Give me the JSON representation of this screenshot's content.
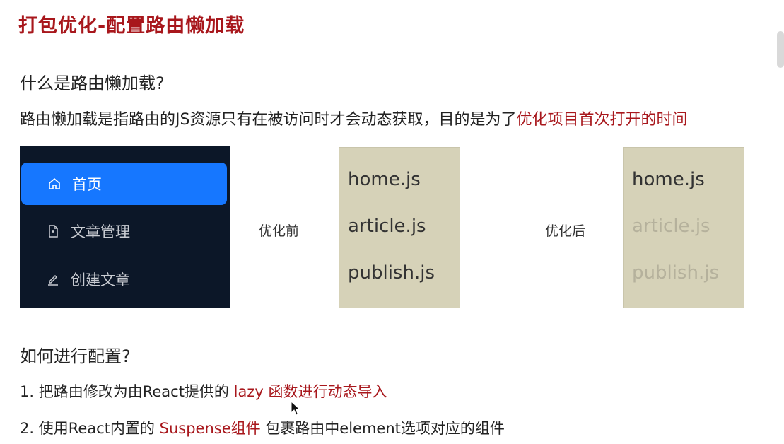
{
  "title": "打包优化-配置路由懒加载",
  "section1": {
    "question": "什么是路由懒加载?",
    "desc_plain": "路由懒加载是指路由的JS资源只有在被访问时才会动态获取，目的是为了",
    "desc_highlight": "优化项目首次打开的时间"
  },
  "menu": {
    "items": [
      {
        "label": "首页",
        "icon": "home-icon",
        "active": true
      },
      {
        "label": "文章管理",
        "icon": "document-icon",
        "active": false
      },
      {
        "label": "创建文章",
        "icon": "edit-icon",
        "active": false
      }
    ],
    "colors": {
      "background": "#0c1728",
      "active": "#1677ff"
    }
  },
  "before": {
    "label": "优化前",
    "files": [
      "home.js",
      "article.js",
      "publish.js"
    ]
  },
  "after": {
    "label": "优化后",
    "files": [
      "home.js",
      "article.js",
      "publish.js"
    ],
    "loaded": [
      true,
      false,
      false
    ]
  },
  "section2": {
    "question": "如何进行配置?",
    "step1_plain": "1. 把路由修改为由React提供的 ",
    "step1_highlight": "lazy 函数进行动态导入",
    "step2_plain_a": "2. 使用React内置的 ",
    "step2_highlight": "Suspense组件",
    "step2_plain_b": " 包裹路由中element选项对应的组件"
  },
  "colors": {
    "accent_red": "#a8171c",
    "file_panel": "#d6d2b8"
  }
}
